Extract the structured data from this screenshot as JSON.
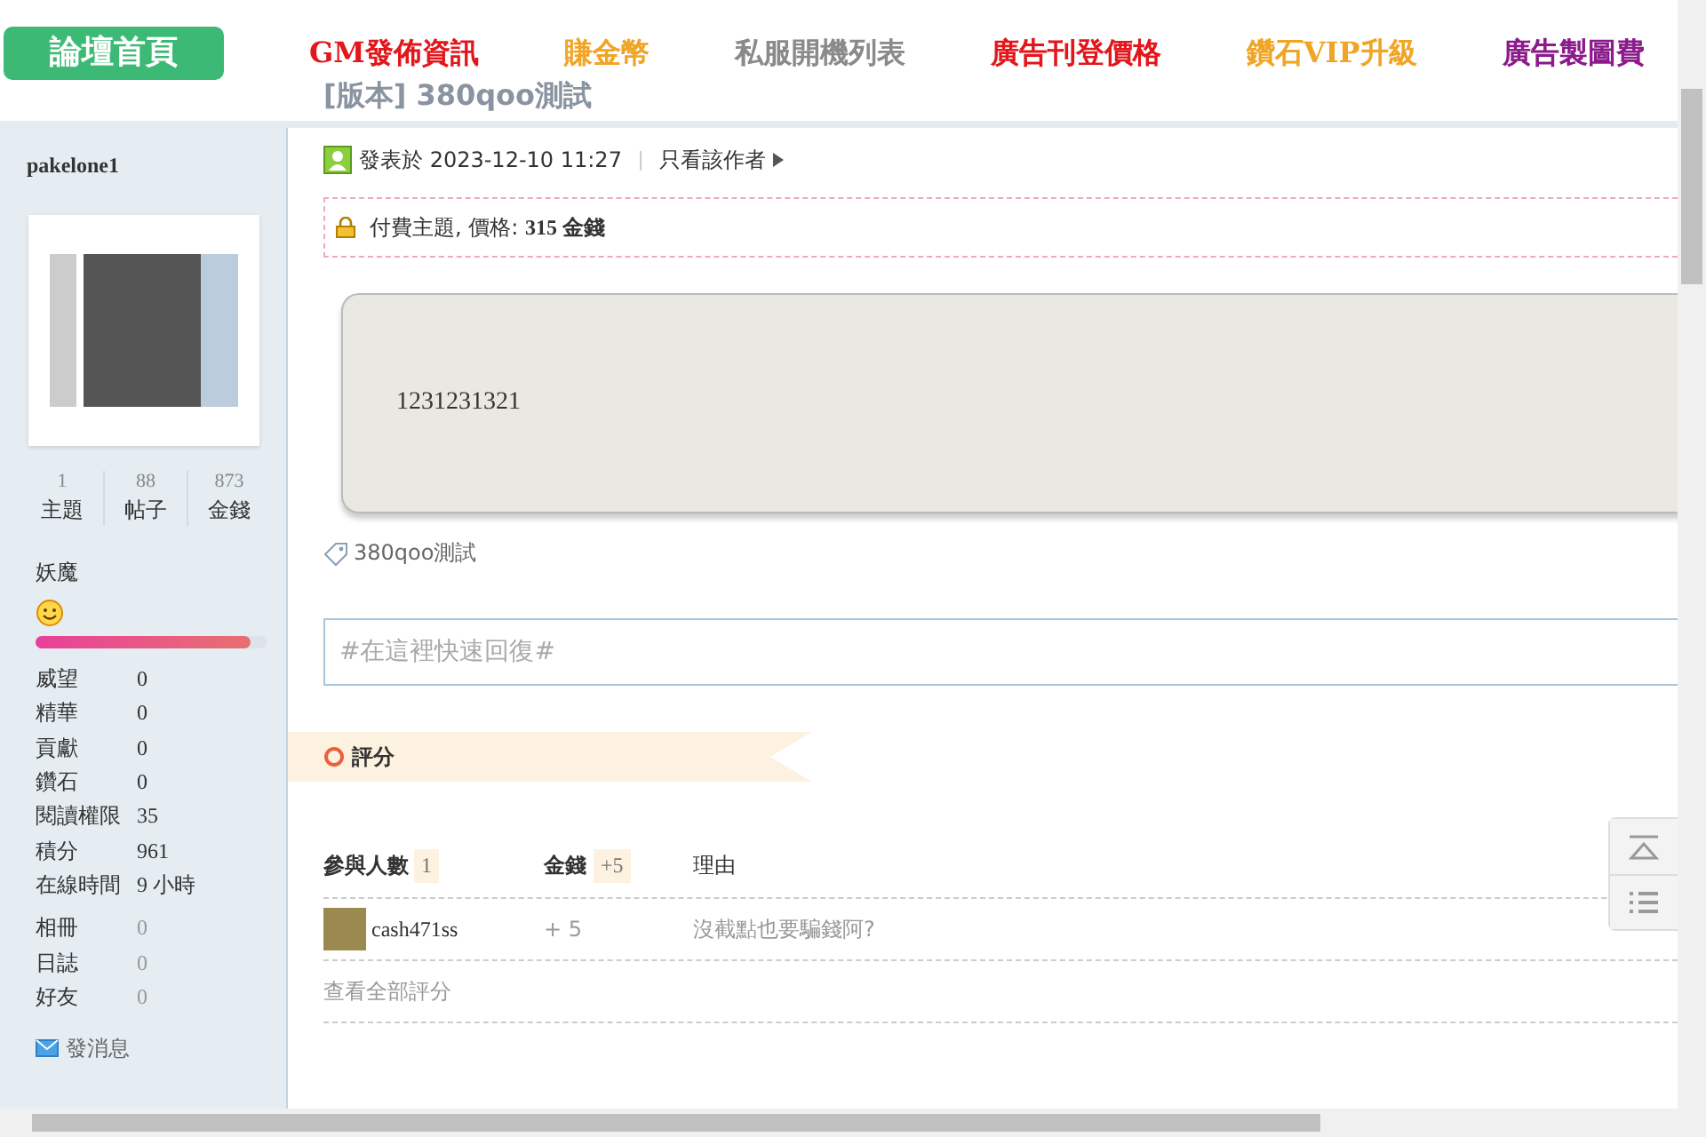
{
  "nav": [
    {
      "label": "論壇首頁",
      "kind": "home"
    },
    {
      "label": "GM發佈資訊",
      "kind": "link",
      "color": "#e3161b"
    },
    {
      "label": "賺金幣",
      "kind": "link",
      "color": "#f0a526"
    },
    {
      "label": "私服開機列表",
      "kind": "link",
      "color": "#8a8a8a"
    },
    {
      "label": "廣告刊登價格",
      "kind": "link",
      "color": "#e3161b"
    },
    {
      "label": "鑽石VIP升級",
      "kind": "link",
      "color": "#f0a526"
    },
    {
      "label": "廣告製圖費",
      "kind": "link",
      "color": "#8b1a8b"
    }
  ],
  "thread_title": "[版本] 380qoo測試",
  "author": {
    "name": "pakelone1",
    "stats": [
      {
        "value": "1",
        "label": "主題"
      },
      {
        "value": "88",
        "label": "帖子"
      },
      {
        "value": "873",
        "label": "金錢"
      }
    ],
    "rank": "妖魔",
    "level": 0.93,
    "info": [
      {
        "label": "威望",
        "value": "0"
      },
      {
        "label": "精華",
        "value": "0"
      },
      {
        "label": "貢獻",
        "value": "0"
      },
      {
        "label": "鑽石",
        "value": "0"
      },
      {
        "label": "閱讀權限",
        "value": "35"
      },
      {
        "label": "積分",
        "value": "961"
      },
      {
        "label": "在線時間",
        "value": "9 小時"
      }
    ],
    "extra": [
      {
        "label": "相冊",
        "value": "0"
      },
      {
        "label": "日誌",
        "value": "0"
      },
      {
        "label": "好友",
        "value": "0"
      }
    ],
    "message_link": "發消息"
  },
  "post": {
    "posted": "發表於 2023-12-10 11:27",
    "author_only": "只看該作者",
    "paid_notice": "付費主題, 價格: **315 金錢**",
    "body": "1231231321",
    "tag": "380qoo測試"
  },
  "quick_reply": {
    "placeholder": "#在這裡快速回復#"
  },
  "rating": {
    "title": "評分",
    "headers": [
      {
        "label": "參與人數",
        "badge": "1"
      },
      {
        "label": "金錢",
        "badge": "+5"
      },
      {
        "label": "理由"
      }
    ],
    "rows": [
      {
        "user": "cash471ss",
        "amount": "+ 5",
        "reason": "沒截點也要騙錢阿?"
      }
    ],
    "view_all": "查看全部評分"
  }
}
